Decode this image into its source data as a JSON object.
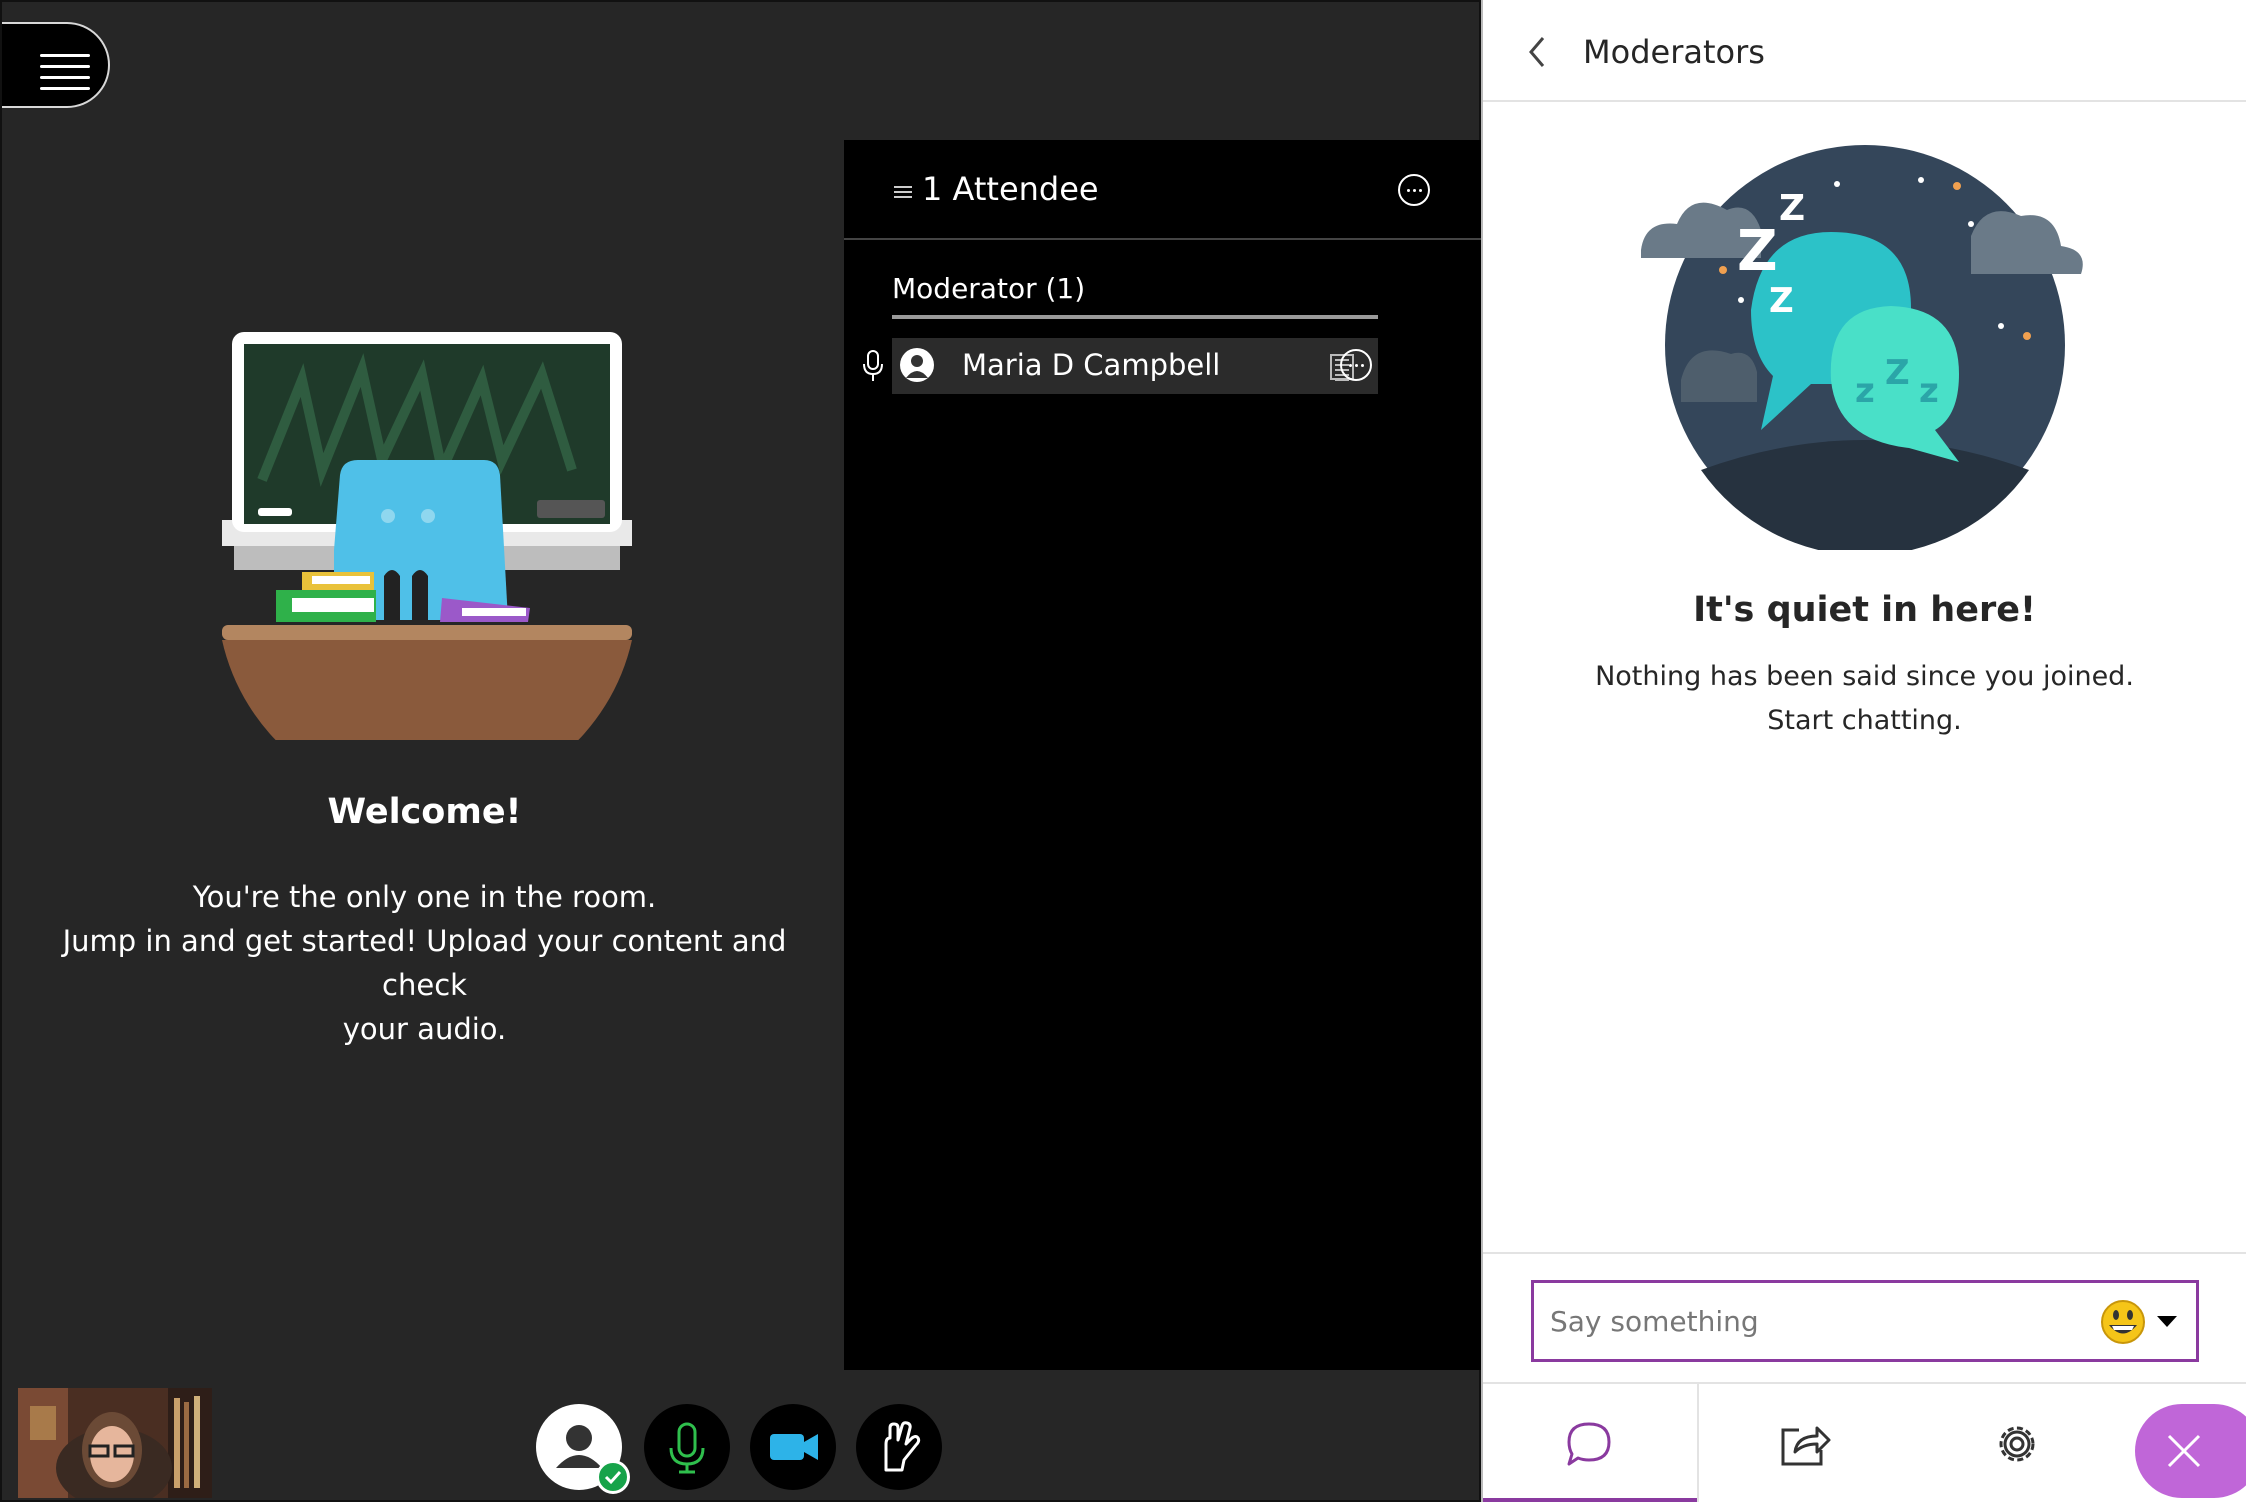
{
  "stage": {
    "welcome_title": "Welcome!",
    "welcome_line1": "You're the only one in the room.",
    "welcome_line2": "Jump in and get started! Upload your content and check",
    "welcome_line3": "your audio."
  },
  "attendees": {
    "title": "1 Attendee",
    "groups": [
      {
        "label": "Moderator (1)",
        "members": [
          {
            "name": "Maria D Campbell"
          }
        ]
      }
    ]
  },
  "toolbar": {
    "items": [
      "avatar-status",
      "microphone",
      "camera",
      "raise-hand"
    ],
    "mic_color": "#2fbf4d",
    "camera_color": "#2db3e8"
  },
  "chat": {
    "panel_title": "Moderators",
    "empty_title": "It's quiet in here!",
    "empty_line1": "Nothing has been said since you joined.",
    "empty_line2": "Start chatting.",
    "input_placeholder": "Say something",
    "accent": "#8a3a9f",
    "tabs": [
      "chat",
      "share-content",
      "settings",
      "close-panel"
    ]
  }
}
